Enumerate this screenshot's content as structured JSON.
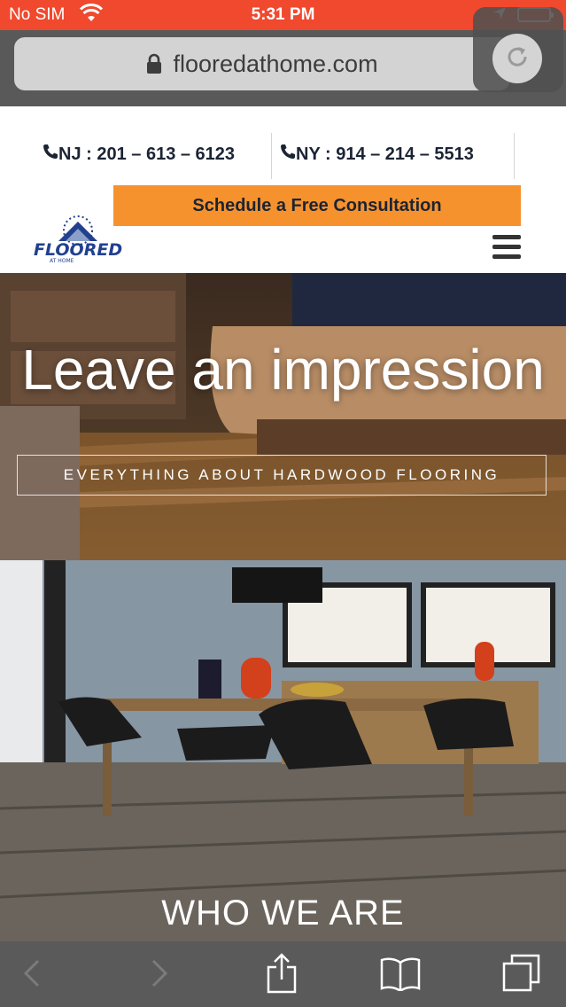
{
  "status_bar": {
    "carrier": "No SIM",
    "time": "5:31 PM"
  },
  "browser": {
    "url": "flooredathome.com"
  },
  "site": {
    "phones": {
      "nj": "NJ : 201 – 613 – 6123",
      "ny": "NY : 914 – 214 – 5513"
    },
    "cta_label": "Schedule a Free Consultation",
    "logo_text": "FLOORED",
    "logo_subtext": "AT HOME",
    "hero": {
      "headline": "Leave an impression",
      "tagline": "EVERYTHING ABOUT HARDWOOD FLOORING"
    },
    "section_title": "WHO WE ARE"
  },
  "colors": {
    "status_bar": "#f0492e",
    "cta": "#f6922e",
    "logo_blue": "#22408f",
    "browser_chrome": "#595959"
  }
}
